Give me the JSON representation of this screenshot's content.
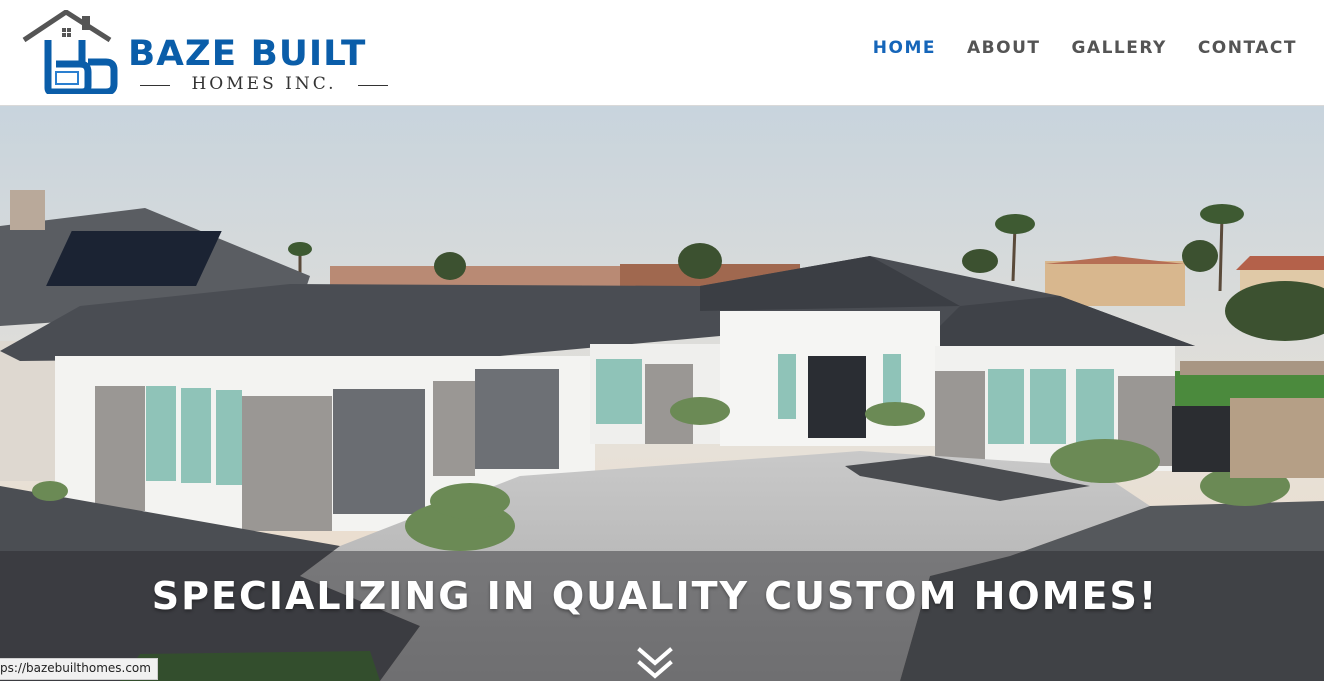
{
  "brand": {
    "name": "BAZE BUILT",
    "subtitle": "HOMES INC.",
    "color": "#0a5da9"
  },
  "nav": {
    "items": [
      {
        "label": "HOME",
        "active": true
      },
      {
        "label": "ABOUT",
        "active": false
      },
      {
        "label": "GALLERY",
        "active": false
      },
      {
        "label": "CONTACT",
        "active": false
      }
    ],
    "active_color": "#1565b9",
    "color": "#545454"
  },
  "hero": {
    "image": "custom single-story home exterior at dusk",
    "tagline": "SPECIALIZING IN QUALITY CUSTOM HOMES!",
    "scroll_icon": "double-chevron-down-icon"
  },
  "status_bar": {
    "url": "ps://bazebuilthomes.com"
  }
}
